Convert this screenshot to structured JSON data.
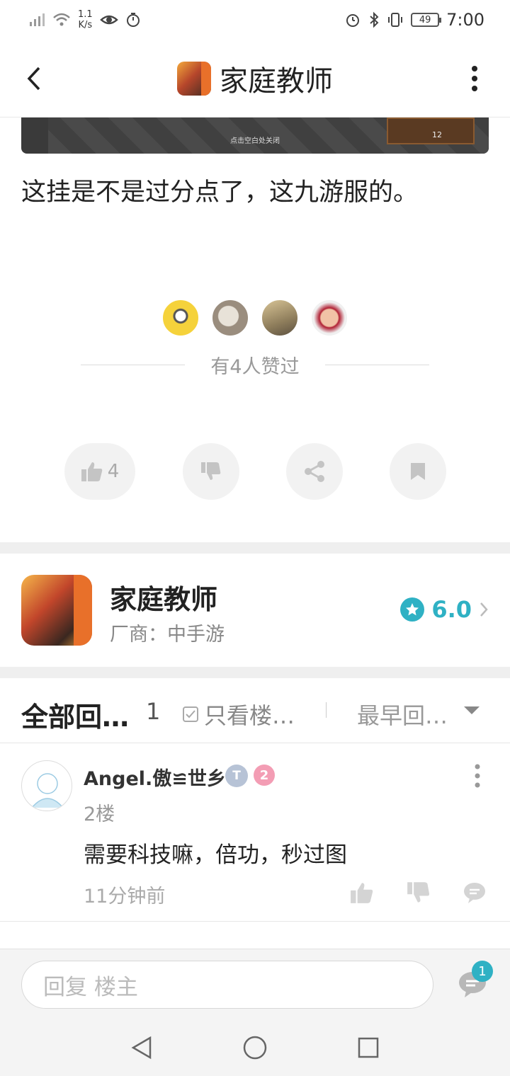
{
  "status_bar": {
    "net_speed_value": "1.1",
    "net_speed_unit": "K/s",
    "battery": "49",
    "time": "7:00"
  },
  "header": {
    "title": "家庭教师"
  },
  "post": {
    "image_hint": "点击空白处关闭",
    "image_thumb_count": "12",
    "text": "这挂是不是过分点了，这九游服的。",
    "liked_by_text": "有4人赞过",
    "like_count": "4"
  },
  "game_card": {
    "name": "家庭教师",
    "vendor": "厂商：中手游",
    "rating": "6.0"
  },
  "replies": {
    "title": "全部回…",
    "count": "1",
    "only_op_label": "只看楼…",
    "sort_label": "最早回…"
  },
  "comment": {
    "username": "Angel.傲≌世乡",
    "badge_t": "T",
    "badge_level": "2",
    "floor": "2楼",
    "text": "需要科技嘛，倍功，秒过图",
    "time": "11分钟前"
  },
  "input_bar": {
    "placeholder": "回复 楼主",
    "comments_badge": "1"
  },
  "colors": {
    "accent": "#2fb1c4",
    "icon_gray": "#c4c4c4"
  },
  "icons": [
    "back-icon",
    "more-icon",
    "thumb-up-icon",
    "thumb-down-icon",
    "share-icon",
    "bookmark-icon",
    "star-icon",
    "chevron-right-icon",
    "comment-icon"
  ]
}
